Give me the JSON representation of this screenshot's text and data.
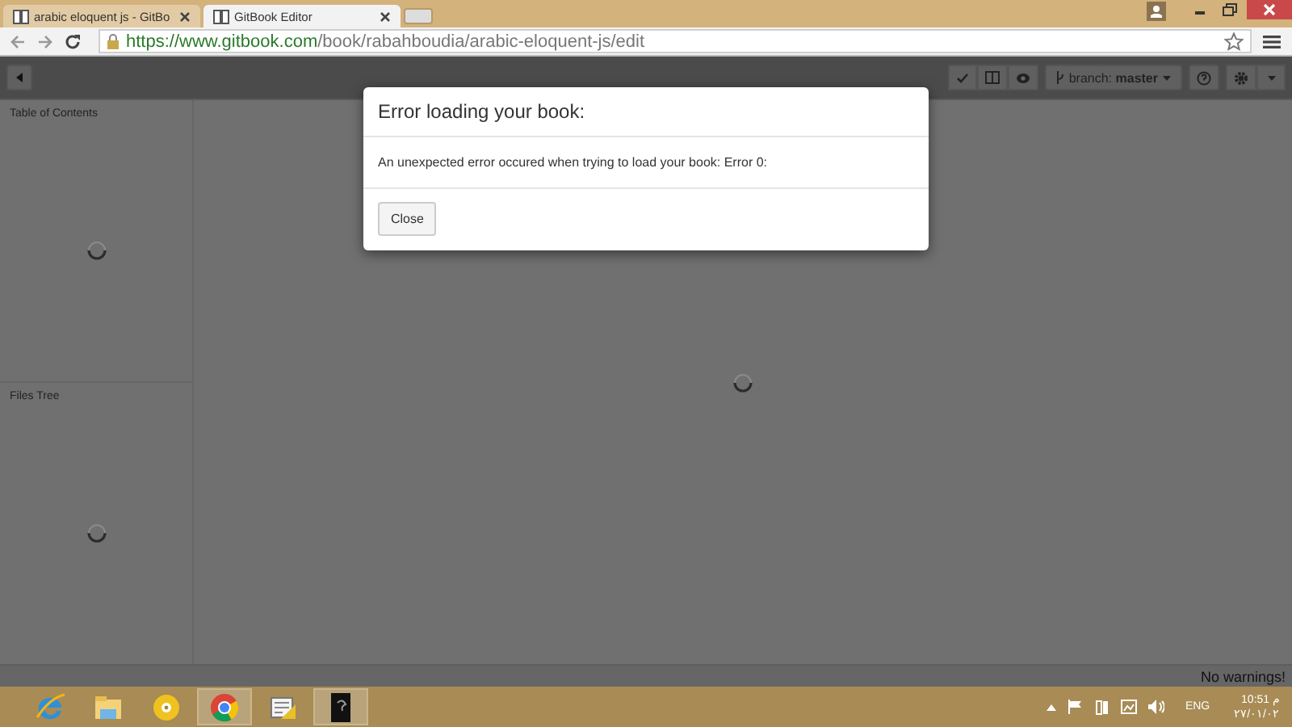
{
  "browser": {
    "tabs": [
      {
        "title": "arabic eloquent js - GitBo",
        "selected": false
      },
      {
        "title": "GitBook Editor",
        "selected": true
      }
    ],
    "url": {
      "host": "https://www.gitbook.com",
      "path": "/book/rabahboudia/arabic-eloquent-js/edit"
    }
  },
  "toolbar": {
    "branch": "branch: **master**"
  },
  "sidebar": {
    "sections": [
      {
        "title": "Table of Contents",
        "loading": true
      },
      {
        "title": "Files Tree",
        "loading": true
      }
    ]
  },
  "editor": {
    "loading": true
  },
  "dialog": {
    "title": "Error loading your book:",
    "message": "An unexpected error occured when trying to load your book: Error 0:",
    "buttons": [
      "Close"
    ]
  },
  "status_bar": {
    "text": "No warnings!"
  },
  "taskbar": {
    "apps": [
      {
        "kind": "ie",
        "running": false
      },
      {
        "kind": "folder",
        "running": false
      },
      {
        "kind": "disc",
        "running": false
      },
      {
        "kind": "chrome",
        "running": true
      },
      {
        "kind": "notes",
        "running": false
      },
      {
        "kind": "dark",
        "running": true
      }
    ],
    "language": "ENG",
    "time": "10:51 م",
    "date": "٢٧/٠١/٠٢"
  }
}
